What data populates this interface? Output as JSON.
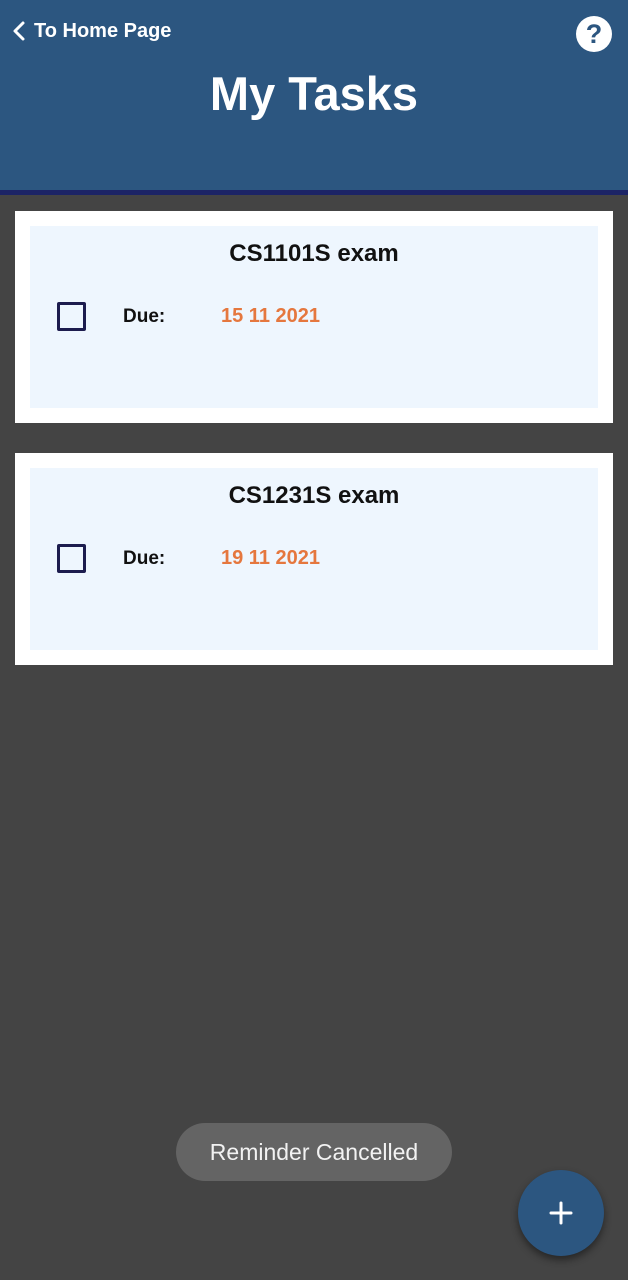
{
  "header": {
    "back_label": "To Home Page",
    "title": "My Tasks",
    "help_icon": "question-circle-icon",
    "back_icon": "chevron-left-icon"
  },
  "tasks": [
    {
      "title": "CS1101S exam",
      "due_label": "Due:",
      "due_date": "15 11 2021",
      "checked": false
    },
    {
      "title": "CS1231S exam",
      "due_label": "Due:",
      "due_date": "19 11 2021",
      "checked": false
    }
  ],
  "toast": {
    "message": "Reminder Cancelled"
  },
  "fab": {
    "icon": "plus-icon"
  },
  "colors": {
    "header_bg": "#2c5680",
    "header_border": "#1c2466",
    "page_bg": "#444444",
    "card_bg": "#ffffff",
    "card_inner_bg": "#eef6fe",
    "due_date": "#e5773e"
  }
}
